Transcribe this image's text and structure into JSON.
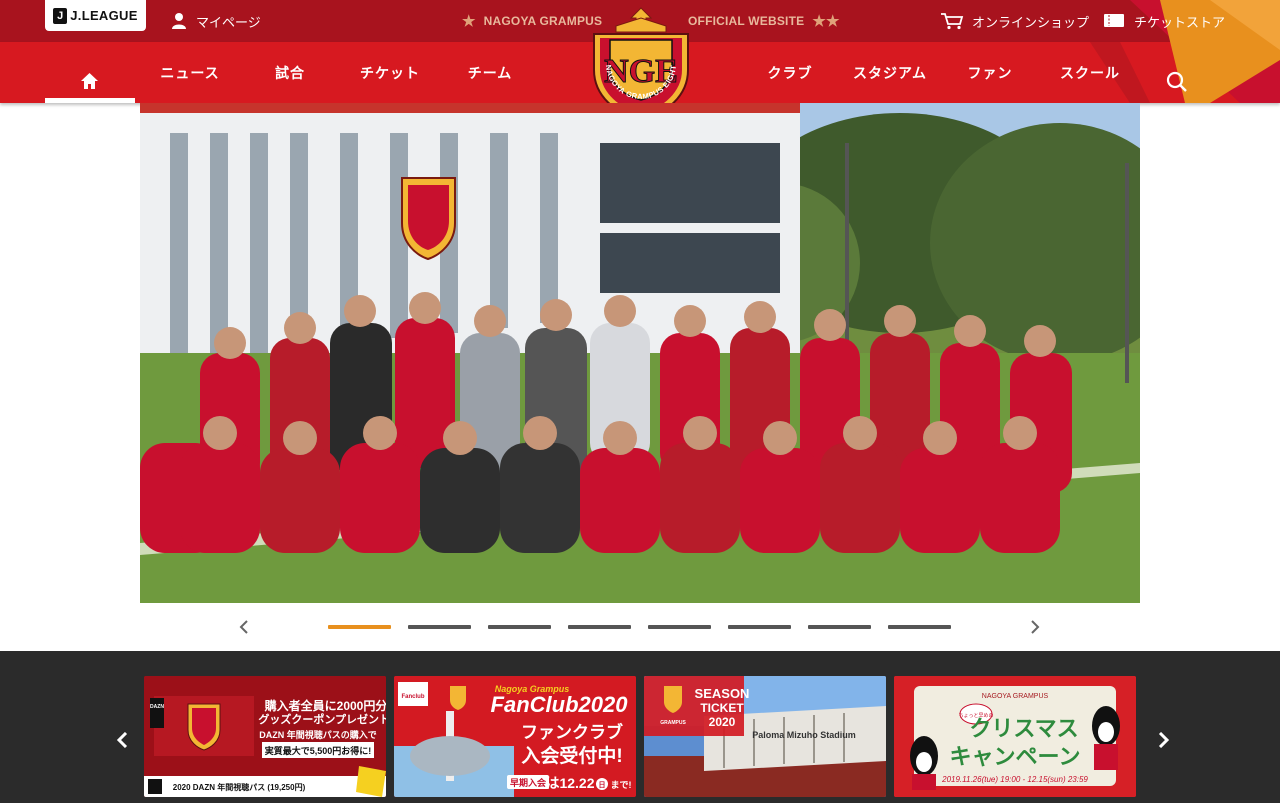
{
  "header": {
    "jleague_label": "J.LEAGUE",
    "mypage_label": "マイページ",
    "brand_left": "NAGOYA GRAMPUS",
    "brand_right": "OFFICIAL WEBSITE",
    "shop_label": "オンラインショップ",
    "ticket_store_label": "チケットストア",
    "emblem_text": "NGE",
    "emblem_ring_text": "NAGOYA GRAMPUS EIGHT"
  },
  "nav": {
    "items": [
      "ニュース",
      "試合",
      "チケット",
      "チーム",
      "クラブ",
      "スタジアム",
      "ファン",
      "スクール"
    ]
  },
  "hero": {
    "slide_count": 8,
    "active_index": 0
  },
  "banners": [
    {
      "brand": "DAZN",
      "headline_1": "購入者全員に2000円分",
      "headline_2": "グッズクーポンプレゼント!",
      "body_1": "DAZN 年間視聴パスの購入で",
      "body_2": "実質最大で5,500円お得に!",
      "footer": "2020 DAZN 年間視聴パス (19,250円)"
    },
    {
      "title_1": "Nagoya Grampus",
      "title_2": "FanClub2020",
      "text_1": "ファンクラブ",
      "text_2": "入会受付中!",
      "badge": "早期入会",
      "deadline": "は12.22",
      "deadline_day": "日",
      "deadline_suffix": "まで!",
      "fanclub_tag": "Fanclub"
    },
    {
      "title_1": "SEASON",
      "title_2": "TICKET",
      "title_3": "2020",
      "club": "GRAMPUS",
      "stadium": "Paloma Mizuho Stadium"
    },
    {
      "header": "NAGOYA GRAMPUS",
      "title_1": "クリスマス",
      "title_2": "キャンペーン",
      "bubble": "ちょっと早めの",
      "dates": "2019.11.26(tue) 19:00 - 12.15(sun) 23:59"
    }
  ],
  "colors": {
    "topbar": "#a8131e",
    "navbar": "#d71920",
    "accent_orange": "#e8901e",
    "dark_band": "#2b2b2b"
  }
}
